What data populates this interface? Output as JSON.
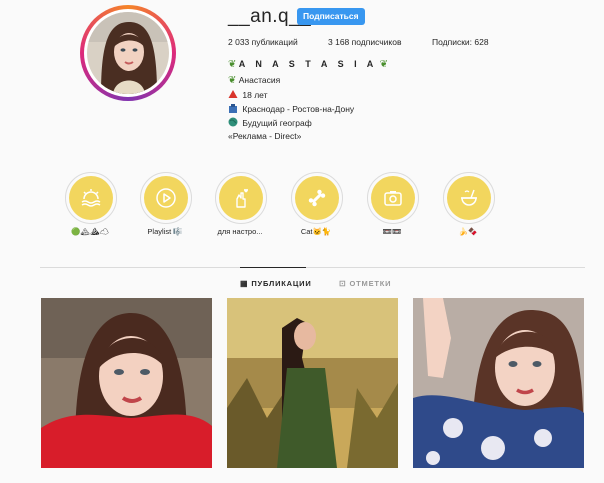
{
  "profile": {
    "username": "__an.q__",
    "follow_label": "Подписаться"
  },
  "stats": {
    "posts": "2 033 публикаций",
    "followers": "3 168 подписчиков",
    "following": "Подписки: 628"
  },
  "bio": {
    "name": "A N A S T A S I A",
    "lines": [
      "Анастасия",
      "18 лет",
      "Краснодар - Ростов-на-Дону",
      "Будущий географ",
      "«Реклама - Direct»"
    ]
  },
  "highlights": [
    {
      "label": "🟢🏔⛰☁",
      "icon": "sun-sea-icon"
    },
    {
      "label": "Playlist 🎼",
      "icon": "play-icon"
    },
    {
      "label": "для настро...",
      "icon": "finger-heart-icon"
    },
    {
      "label": "Cat🐱🐈",
      "icon": "bone-icon"
    },
    {
      "label": "📼📼",
      "icon": "camera-icon"
    },
    {
      "label": "🍌🍫",
      "icon": "coconut-icon"
    }
  ],
  "tabs": [
    {
      "label": "ПУБЛИКАЦИИ",
      "icon": "grid-icon",
      "active": true
    },
    {
      "label": "ОТМЕТКИ",
      "icon": "tag-icon",
      "active": false
    }
  ],
  "colors": {
    "accent": "#3897f0",
    "highlight": "#f2d65e",
    "text": "#262626",
    "border": "#dbdbdb"
  }
}
